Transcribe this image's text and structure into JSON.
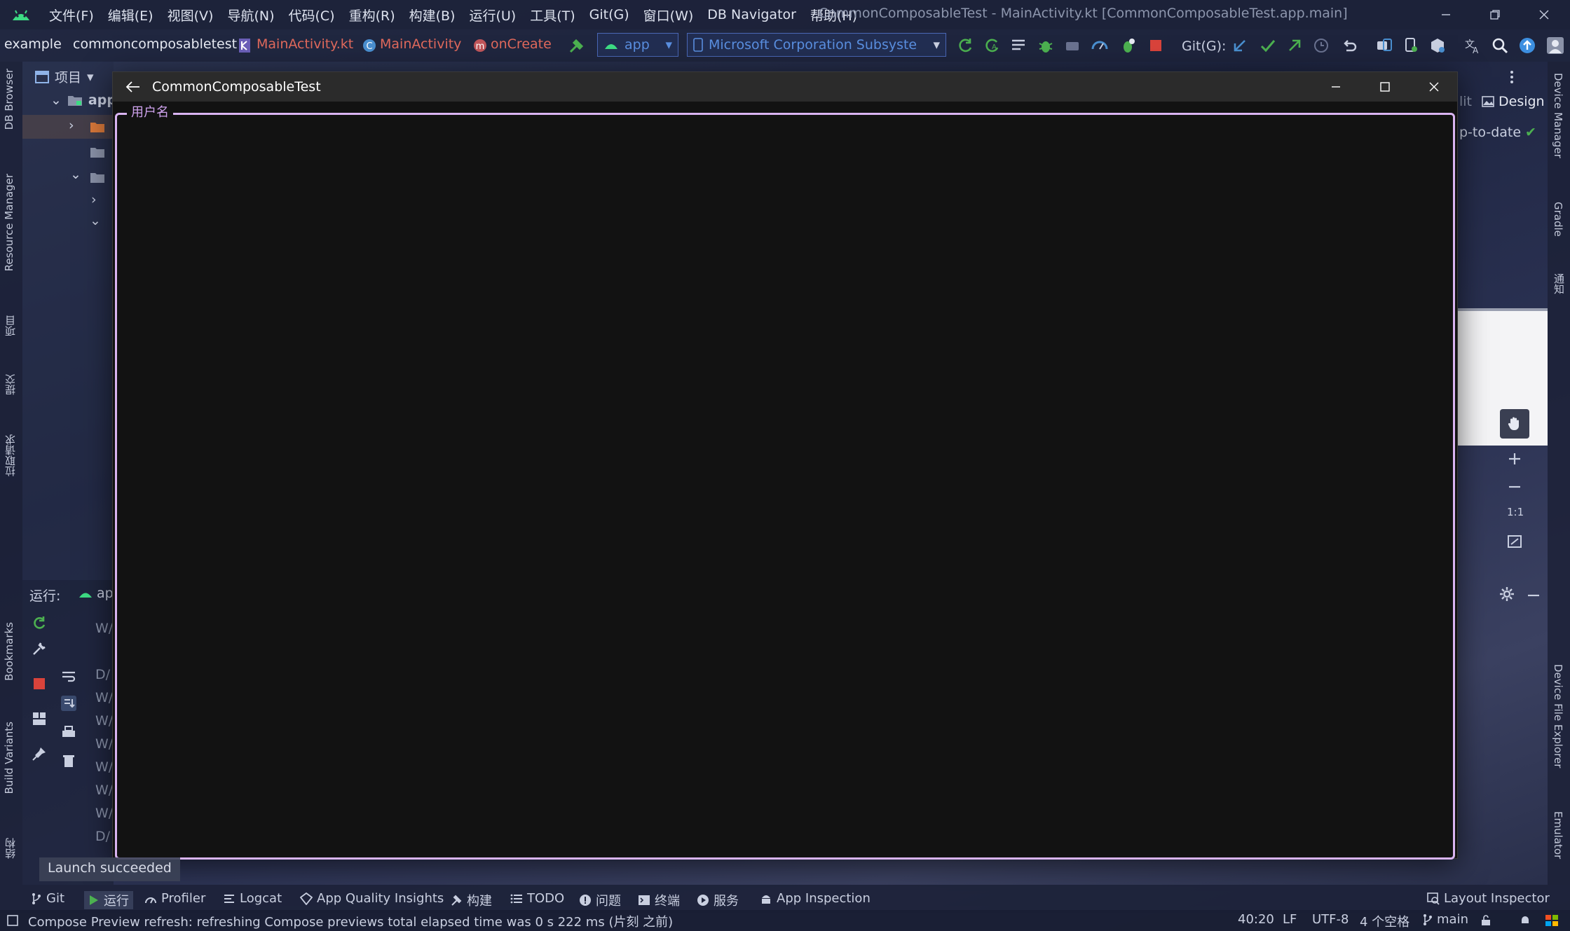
{
  "menubar": {
    "items": [
      "文件(F)",
      "编辑(E)",
      "视图(V)",
      "导航(N)",
      "代码(C)",
      "重构(R)",
      "构建(B)",
      "运行(U)",
      "工具(T)",
      "Git(G)",
      "窗口(W)",
      "DB Navigator",
      "帮助(H)"
    ],
    "window_title": "CommonComposableTest - MainActivity.kt [CommonComposableTest.app.main]"
  },
  "breadcrumbs": {
    "items": [
      "example",
      "commoncomposabletest",
      "MainActivity.kt",
      "MainActivity",
      "onCreate"
    ]
  },
  "toolbar": {
    "run_config": "app",
    "device": "Microsoft Corporation Subsystem f",
    "git_label": "Git(G):"
  },
  "left_strip": {
    "labels": [
      "DB Browser",
      "Resource Manager",
      "项目",
      "提交",
      "拉取请求",
      "Bookmarks",
      "Build Variants",
      "结构"
    ]
  },
  "right_strip": {
    "labels": [
      "Device Manager",
      "Gradle",
      "通知",
      "Device File Explorer",
      "Emulator"
    ]
  },
  "project_panel": {
    "header": "项目",
    "root": "app"
  },
  "run_panel": {
    "label": "运行:",
    "tab": "ap",
    "log_prefixes": [
      "W/",
      "D/",
      "W/",
      "W/",
      "W/",
      "W/",
      "W/",
      "W/",
      "D/"
    ]
  },
  "editor_right": {
    "split_label": "lit",
    "design_label": "Design",
    "status": "p-to-date",
    "zoom_reset": "1:1"
  },
  "app_window": {
    "title": "CommonComposableTest",
    "field_label": "用户名",
    "field_value": ""
  },
  "toast": {
    "text": "Launch succeeded"
  },
  "bottom_tools": {
    "items": [
      "Git",
      "运行",
      "Profiler",
      "Logcat",
      "App Quality Insights",
      "构建",
      "TODO",
      "问题",
      "终端",
      "服务",
      "App Inspection"
    ],
    "layout_inspector": "Layout Inspector"
  },
  "statusbar": {
    "message": "Compose Preview refresh: refreshing Compose previews total elapsed time was 0 s 222 ms (片刻 之前)",
    "position": "40:20",
    "line_sep": "LF",
    "encoding": "UTF-8",
    "indent": "4 个空格",
    "branch": "main"
  },
  "colors": {
    "accent_purple": "#d9b4f2",
    "label_purple": "#cfa3ee",
    "app_bg": "#121212",
    "ide_blue": "#4a67b6",
    "android_green": "#3ddc84",
    "crumb_red": "#e0695c"
  }
}
